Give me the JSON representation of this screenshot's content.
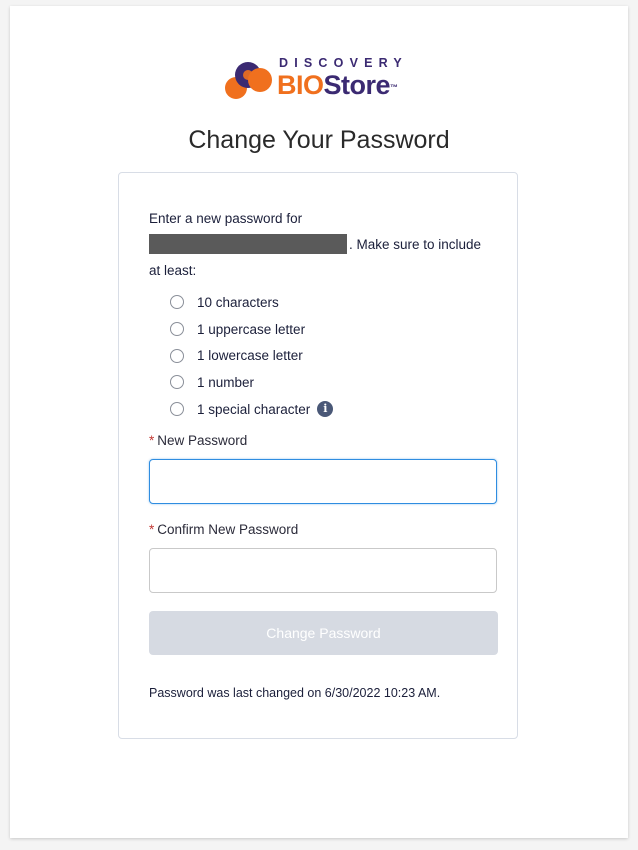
{
  "logo": {
    "top_text": "DISCOVERY",
    "brand_part1": "BIO",
    "brand_part2": "Store",
    "trademark": "™",
    "colors": {
      "orange": "#f0701e",
      "purple": "#3b2a72"
    }
  },
  "page_title": "Change Your Password",
  "instructions": {
    "line1": "Enter a new password for",
    "line2_suffix": ". Make sure to include",
    "line3": "at least:"
  },
  "requirements": [
    {
      "label": "10 characters"
    },
    {
      "label": "1 uppercase letter"
    },
    {
      "label": "1 lowercase letter"
    },
    {
      "label": "1 number"
    },
    {
      "label": "1 special character",
      "info_icon": "info-icon"
    }
  ],
  "fields": {
    "new_password": {
      "label": "New Password",
      "required_marker": "*",
      "value": ""
    },
    "confirm_password": {
      "label": "Confirm New Password",
      "required_marker": "*",
      "value": ""
    }
  },
  "submit_button": {
    "label": "Change Password",
    "state": "disabled"
  },
  "footer_note": "Password was last changed on 6/30/2022 10:23 AM.",
  "colors": {
    "focus_border": "#2f8de0",
    "required": "#c23934",
    "disabled_button": "#d6dae2"
  }
}
